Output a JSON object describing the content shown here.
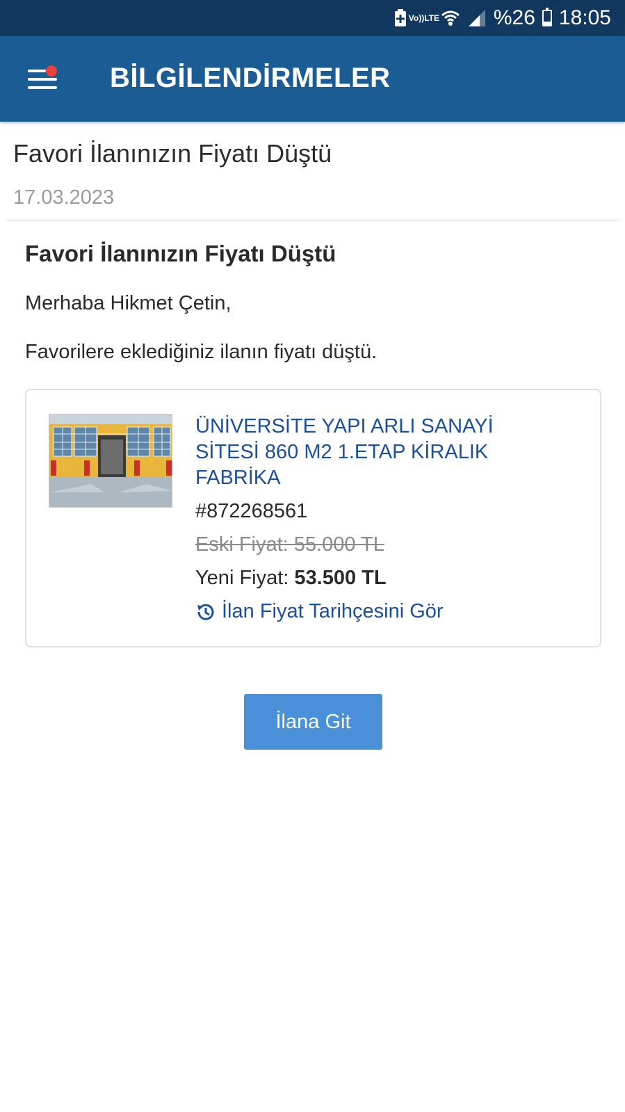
{
  "status_bar": {
    "lte_top": "Vo))",
    "lte_bottom": "LTE",
    "battery_percent": "%26",
    "battery_level": 0.26,
    "time": "18:05",
    "icons": [
      "battery-saver-icon",
      "volte-icon",
      "wifi-icon",
      "signal-icon",
      "battery-icon"
    ]
  },
  "app_bar": {
    "title": "BİLGİLENDİRMELER",
    "menu_icon": "hamburger-menu-icon",
    "notification_dot_color": "#e8413c",
    "background": "#1b5c94"
  },
  "notification": {
    "title": "Favori İlanınızın Fiyatı Düştü",
    "date": "17.03.2023"
  },
  "message": {
    "heading": "Favori İlanınızın Fiyatı Düştü",
    "greeting": "Merhaba Hikmet Çetin,",
    "body": "Favorilere eklediğiniz ilanın fiyatı düştü."
  },
  "listing": {
    "title": "ÜNİVERSİTE YAPI ARLI SANAYİ SİTESİ 860 M2 1.ETAP KİRALIK FABRİKA",
    "id": "#872268561",
    "old_price": "Eski Fiyat: 55.000 TL",
    "new_price_label": "Yeni Fiyat: ",
    "new_price_value": "53.500 TL",
    "history_link": "İlan Fiyat Tarihçesini Gör",
    "history_icon": "history-icon",
    "link_color": "#1c4f9c"
  },
  "actions": {
    "go_button": "İlana Git",
    "button_color": "#4a90d9"
  }
}
